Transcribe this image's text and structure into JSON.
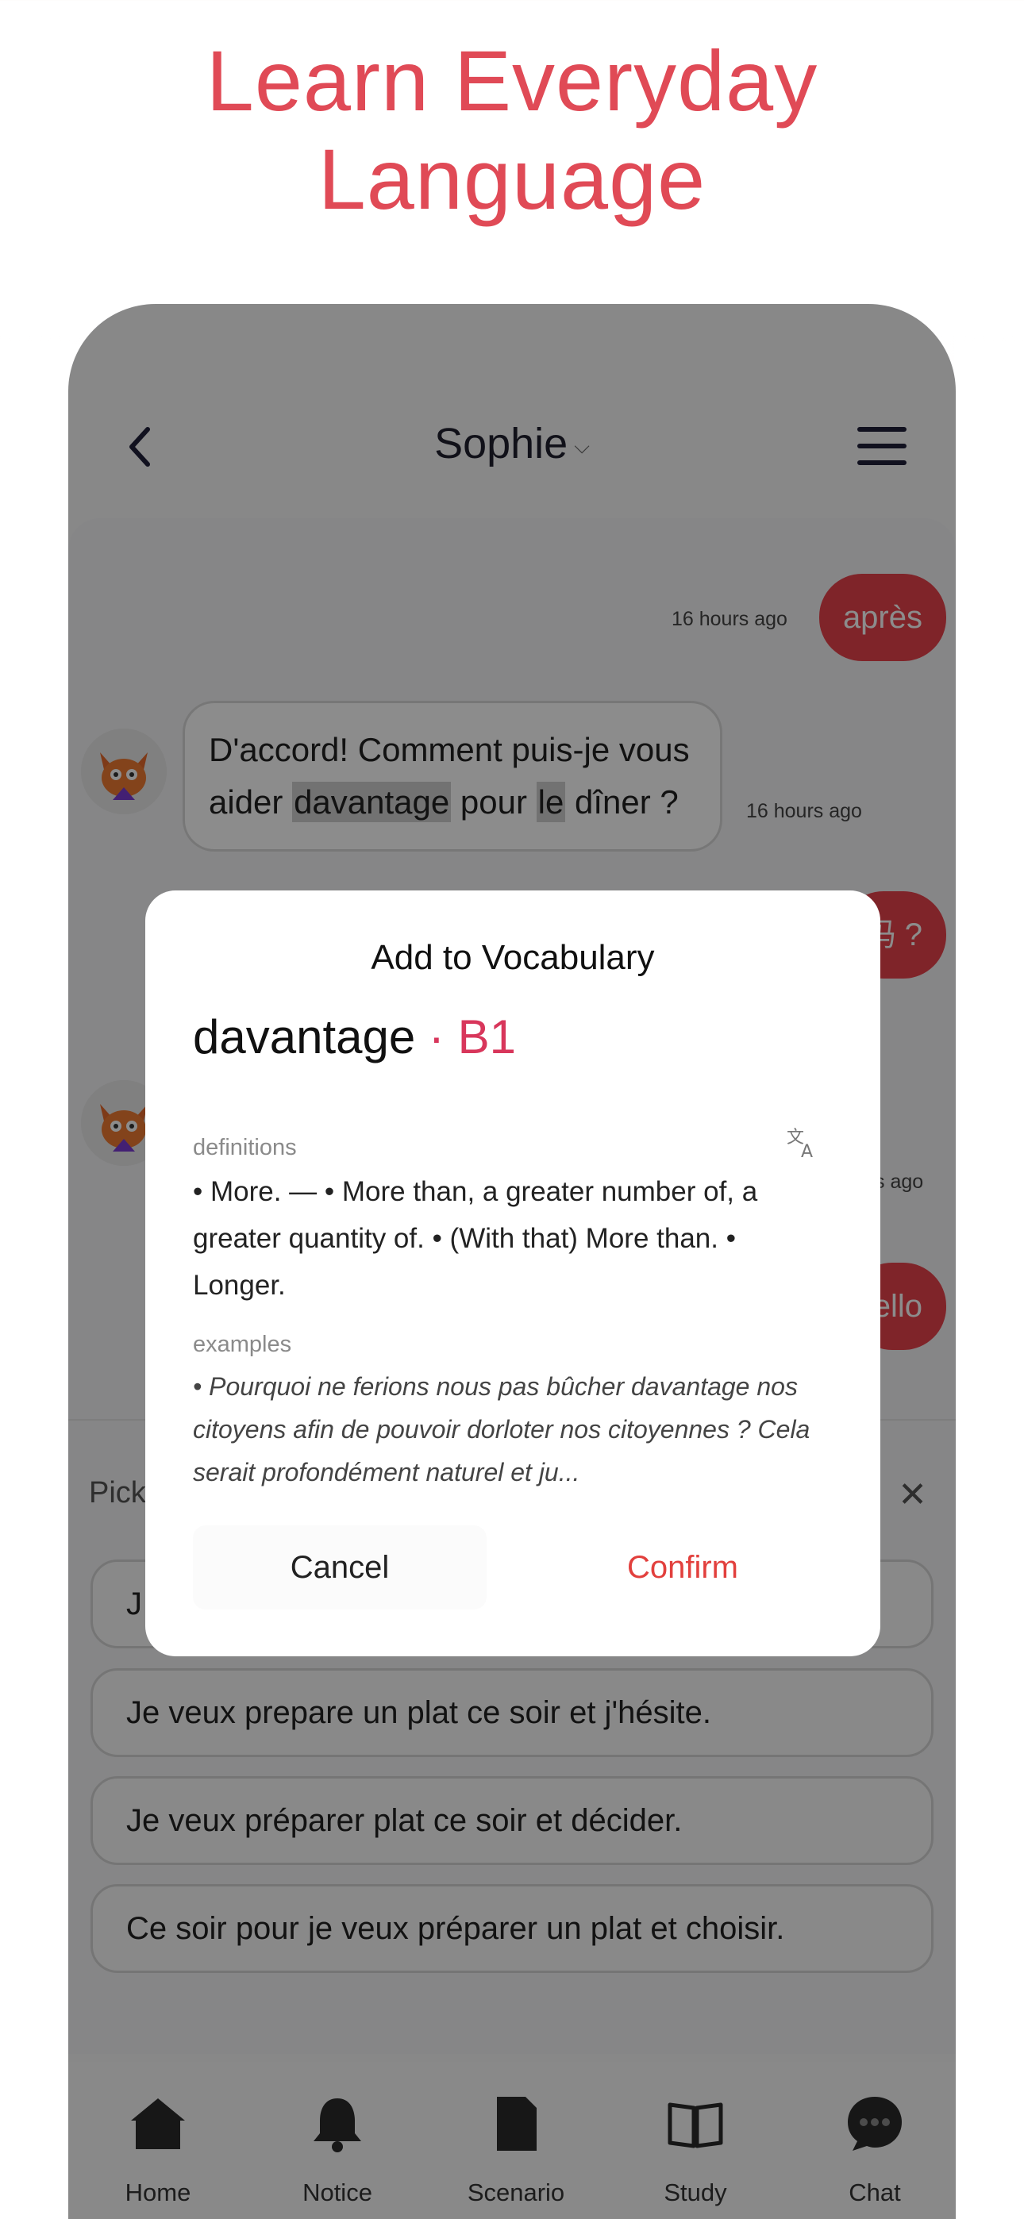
{
  "headline": {
    "line1": "Learn Everyday",
    "line2": "Language"
  },
  "nav": {
    "title": "Sophie",
    "chevron": "⌵"
  },
  "messages": [
    {
      "role": "me",
      "text": "après",
      "time": "16 hours ago"
    },
    {
      "role": "ai",
      "line1_a": "D'accord! Comment puis-je vous",
      "line2_a": "aider ",
      "hl1": "davantage",
      "line2_b": " pour ",
      "hl2": "le",
      "line2_c": " dîner ?",
      "time": "16 hours ago"
    },
    {
      "role": "me",
      "text": "吗 ?"
    },
    {
      "role": "ai",
      "time": "s ago"
    },
    {
      "role": "me",
      "text": "ello"
    }
  ],
  "pick": {
    "label": "Pick",
    "close": "✕",
    "options": [
      "J",
      "Je veux prepare un plat ce soir et j'hésite.",
      "Je veux préparer plat ce soir et décider.",
      "Ce soir pour je veux préparer un plat et choisir."
    ]
  },
  "tabs": [
    {
      "label": "Home",
      "icon": "home-icon"
    },
    {
      "label": "Notice",
      "icon": "bell-icon"
    },
    {
      "label": "Scenario",
      "icon": "document-icon"
    },
    {
      "label": "Study",
      "icon": "book-icon"
    },
    {
      "label": "Chat",
      "icon": "chat-icon"
    }
  ],
  "dialog": {
    "title": "Add to Vocabulary",
    "word": "davantage",
    "level": " · B1",
    "definitions_label": "definitions",
    "definitions": "• More. — • More than, a greater number of, a greater quantity of. • (With that) More than. • Longer.",
    "examples_label": "examples",
    "examples": "• Pourquoi ne ferions nous pas bûcher davantage nos citoyens afin de pouvoir dorloter nos citoyennes ? Cela serait profondément naturel et ju...",
    "cancel": "Cancel",
    "confirm": "Confirm"
  },
  "colors": {
    "accent": "#e8424b",
    "headline": "#e04a56",
    "level": "#d8365b",
    "confirm": "#e2403d"
  }
}
